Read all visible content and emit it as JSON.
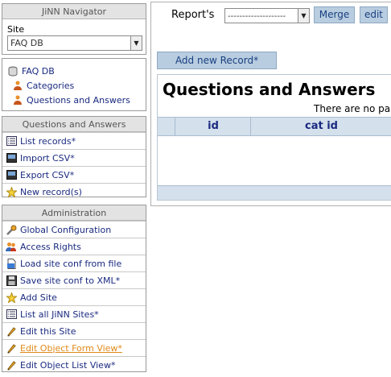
{
  "navigator": {
    "title": "JiNN Navigator",
    "site_label": "Site",
    "site_value": "FAQ DB",
    "items": [
      "FAQ DB",
      "Categories",
      "Questions and Answers"
    ]
  },
  "qa_menu": {
    "title": "Questions and Answers",
    "items": [
      "List records*",
      "Import CSV*",
      "Export CSV*",
      "New record(s)"
    ]
  },
  "admin_menu": {
    "title": "Administration",
    "items": [
      "Global Configuration",
      "Access Rights",
      "Load site conf from file",
      "Save site conf to XML*",
      "Add Site",
      "List all JiNN Sites*",
      "Edit this Site",
      "Edit Object Form View*",
      "Edit Object List View*"
    ]
  },
  "topbar": {
    "reports_label": "Report's",
    "reports_select": "--------------------",
    "merge_button": "Merge",
    "edit_button": "edit"
  },
  "main": {
    "add_button": "Add new Record*",
    "heading": "Questions and Answers",
    "notice": "There are no pa",
    "columns": [
      "id",
      "cat id"
    ]
  },
  "colors": {
    "link": "#1a2a80",
    "highlight": "#e08a1a",
    "button_bg": "#b8cde0",
    "header_bg": "#d4e0ec"
  }
}
